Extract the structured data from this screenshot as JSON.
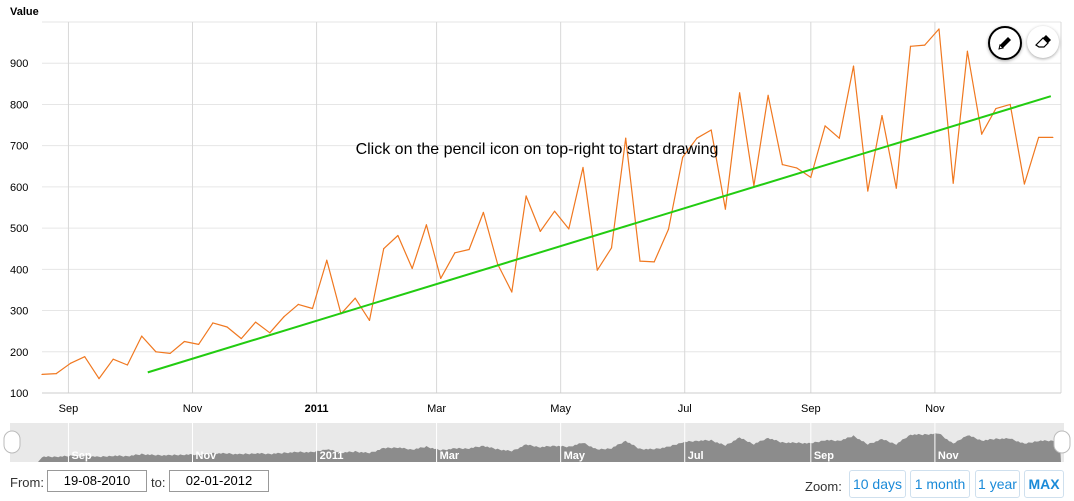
{
  "chart_data": {
    "type": "line",
    "ylabel": "Value",
    "annotation": "Click on the pencil icon on top-right to start drawing",
    "ylim": [
      100,
      1000
    ],
    "y_ticks": [
      100,
      200,
      300,
      400,
      500,
      600,
      700,
      800,
      900
    ],
    "x_range": [
      "2010-08-19",
      "2012-01-02"
    ],
    "x_ticks": [
      {
        "date": "2010-09-01",
        "label": "Sep",
        "bold": false
      },
      {
        "date": "2010-11-01",
        "label": "Nov",
        "bold": false
      },
      {
        "date": "2011-01-01",
        "label": "2011",
        "bold": true
      },
      {
        "date": "2011-03-01",
        "label": "Mar",
        "bold": false
      },
      {
        "date": "2011-05-01",
        "label": "May",
        "bold": false
      },
      {
        "date": "2011-07-01",
        "label": "Jul",
        "bold": false
      },
      {
        "date": "2011-09-01",
        "label": "Sep",
        "bold": false
      },
      {
        "date": "2011-11-01",
        "label": "Nov",
        "bold": false
      }
    ],
    "series": [
      {
        "color": "#f07820",
        "points": [
          [
            "2010-08-19",
            145
          ],
          [
            "2010-08-26",
            147
          ],
          [
            "2010-09-02",
            172
          ],
          [
            "2010-09-09",
            188
          ],
          [
            "2010-09-16",
            135
          ],
          [
            "2010-09-23",
            182
          ],
          [
            "2010-09-30",
            168
          ],
          [
            "2010-10-07",
            238
          ],
          [
            "2010-10-14",
            200
          ],
          [
            "2010-10-21",
            196
          ],
          [
            "2010-10-28",
            225
          ],
          [
            "2010-11-04",
            218
          ],
          [
            "2010-11-11",
            270
          ],
          [
            "2010-11-18",
            260
          ],
          [
            "2010-11-25",
            232
          ],
          [
            "2010-12-02",
            272
          ],
          [
            "2010-12-09",
            246
          ],
          [
            "2010-12-16",
            285
          ],
          [
            "2010-12-23",
            315
          ],
          [
            "2010-12-30",
            305
          ],
          [
            "2011-01-06",
            422
          ],
          [
            "2011-01-13",
            292
          ],
          [
            "2011-01-20",
            330
          ],
          [
            "2011-01-27",
            276
          ],
          [
            "2011-02-03",
            450
          ],
          [
            "2011-02-10",
            482
          ],
          [
            "2011-02-17",
            402
          ],
          [
            "2011-02-24",
            508
          ],
          [
            "2011-03-03",
            378
          ],
          [
            "2011-03-10",
            440
          ],
          [
            "2011-03-17",
            448
          ],
          [
            "2011-03-24",
            538
          ],
          [
            "2011-03-31",
            413
          ],
          [
            "2011-04-07",
            345
          ],
          [
            "2011-04-14",
            578
          ],
          [
            "2011-04-21",
            492
          ],
          [
            "2011-04-28",
            541
          ],
          [
            "2011-05-05",
            498
          ],
          [
            "2011-05-12",
            647
          ],
          [
            "2011-05-19",
            398
          ],
          [
            "2011-05-26",
            452
          ],
          [
            "2011-06-02",
            718
          ],
          [
            "2011-06-09",
            420
          ],
          [
            "2011-06-16",
            418
          ],
          [
            "2011-06-23",
            497
          ],
          [
            "2011-06-30",
            672
          ],
          [
            "2011-07-07",
            718
          ],
          [
            "2011-07-14",
            738
          ],
          [
            "2011-07-21",
            546
          ],
          [
            "2011-07-28",
            828
          ],
          [
            "2011-08-04",
            603
          ],
          [
            "2011-08-11",
            822
          ],
          [
            "2011-08-18",
            654
          ],
          [
            "2011-08-25",
            646
          ],
          [
            "2011-09-01",
            623
          ],
          [
            "2011-09-08",
            748
          ],
          [
            "2011-09-15",
            718
          ],
          [
            "2011-09-22",
            893
          ],
          [
            "2011-09-29",
            590
          ],
          [
            "2011-10-06",
            773
          ],
          [
            "2011-10-13",
            597
          ],
          [
            "2011-10-20",
            941
          ],
          [
            "2011-10-27",
            944
          ],
          [
            "2011-11-03",
            983
          ],
          [
            "2011-11-10",
            609
          ],
          [
            "2011-11-17",
            929
          ],
          [
            "2011-11-24",
            728
          ],
          [
            "2011-12-01",
            790
          ],
          [
            "2011-12-08",
            800
          ],
          [
            "2011-12-15",
            607
          ],
          [
            "2011-12-22",
            720
          ],
          [
            "2011-12-29",
            720
          ]
        ]
      }
    ],
    "trend_line": {
      "color": "#22cc11",
      "points": [
        [
          "2010-10-10",
          150
        ],
        [
          "2011-12-28",
          820
        ]
      ]
    },
    "navigator": {
      "labels": [
        "Sep",
        "Nov",
        "2011",
        "Mar",
        "May",
        "Jul",
        "Sep",
        "Nov"
      ]
    }
  },
  "controls": {
    "from_label": "From:",
    "from_value": "19-08-2010",
    "to_label": "to:",
    "to_value": "02-01-2012",
    "zoom_label": "Zoom:",
    "zoom_buttons": [
      "10 days",
      "1 month",
      "1 year",
      "MAX"
    ]
  },
  "icons": {
    "pencil": "pencil-icon",
    "eraser": "eraser-icon"
  }
}
